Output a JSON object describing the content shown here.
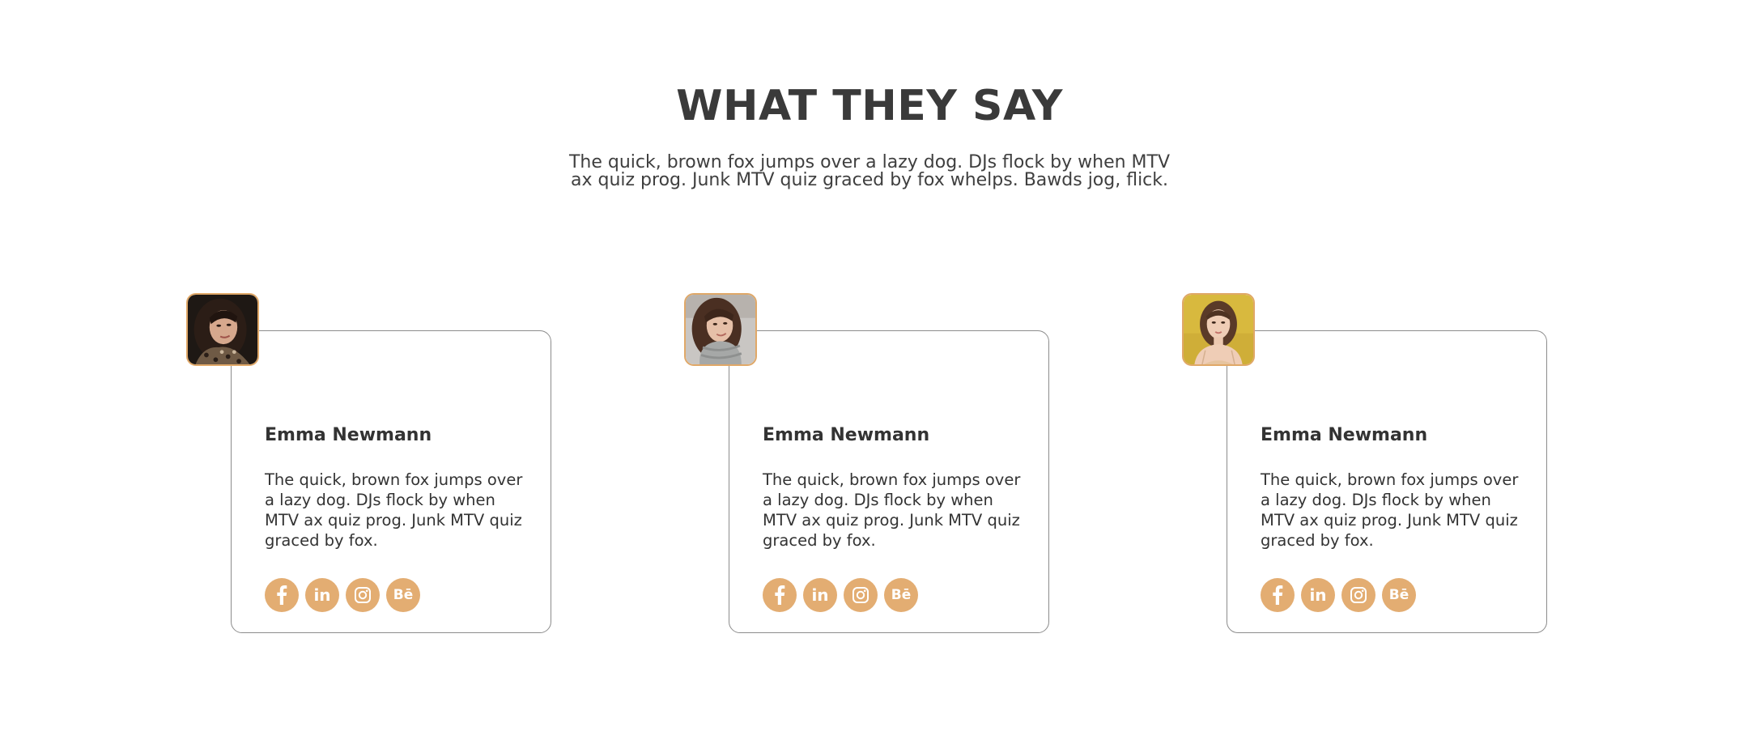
{
  "section": {
    "title": "WHAT THEY SAY",
    "intro_line1": "The quick, brown fox jumps over a lazy dog. DJs flock by when MTV",
    "intro_line2": "ax quiz prog. Junk MTV quiz graced by fox whelps. Bawds jog, flick."
  },
  "testimonials": [
    {
      "name": "Emma Newmann",
      "quote": "The quick, brown fox jumps over a lazy dog. DJs flock by when MTV ax quiz prog. Junk MTV quiz graced by fox.",
      "avatar": "woman-dark-hair-leopard-scarf-photo"
    },
    {
      "name": "Emma Newmann",
      "quote": "The quick, brown fox jumps over a lazy dog. DJs flock by when MTV ax quiz prog. Junk MTV quiz graced by fox.",
      "avatar": "woman-brown-hair-grey-scarf-photo"
    },
    {
      "name": "Emma Newmann",
      "quote": "The quick, brown fox jumps over a lazy dog. DJs flock by when MTV ax quiz prog. Junk MTV quiz graced by fox.",
      "avatar": "woman-yellow-background-photo"
    }
  ],
  "social_icons": [
    "facebook-icon",
    "linkedin-icon",
    "instagram-icon",
    "behance-icon"
  ],
  "social_labels": {
    "linkedin": "in",
    "behance": "Bē"
  },
  "colors": {
    "accent": "#e3ad72",
    "avatar_border": "#e0a868",
    "card_border": "#8c8c8c",
    "text": "#333333"
  }
}
